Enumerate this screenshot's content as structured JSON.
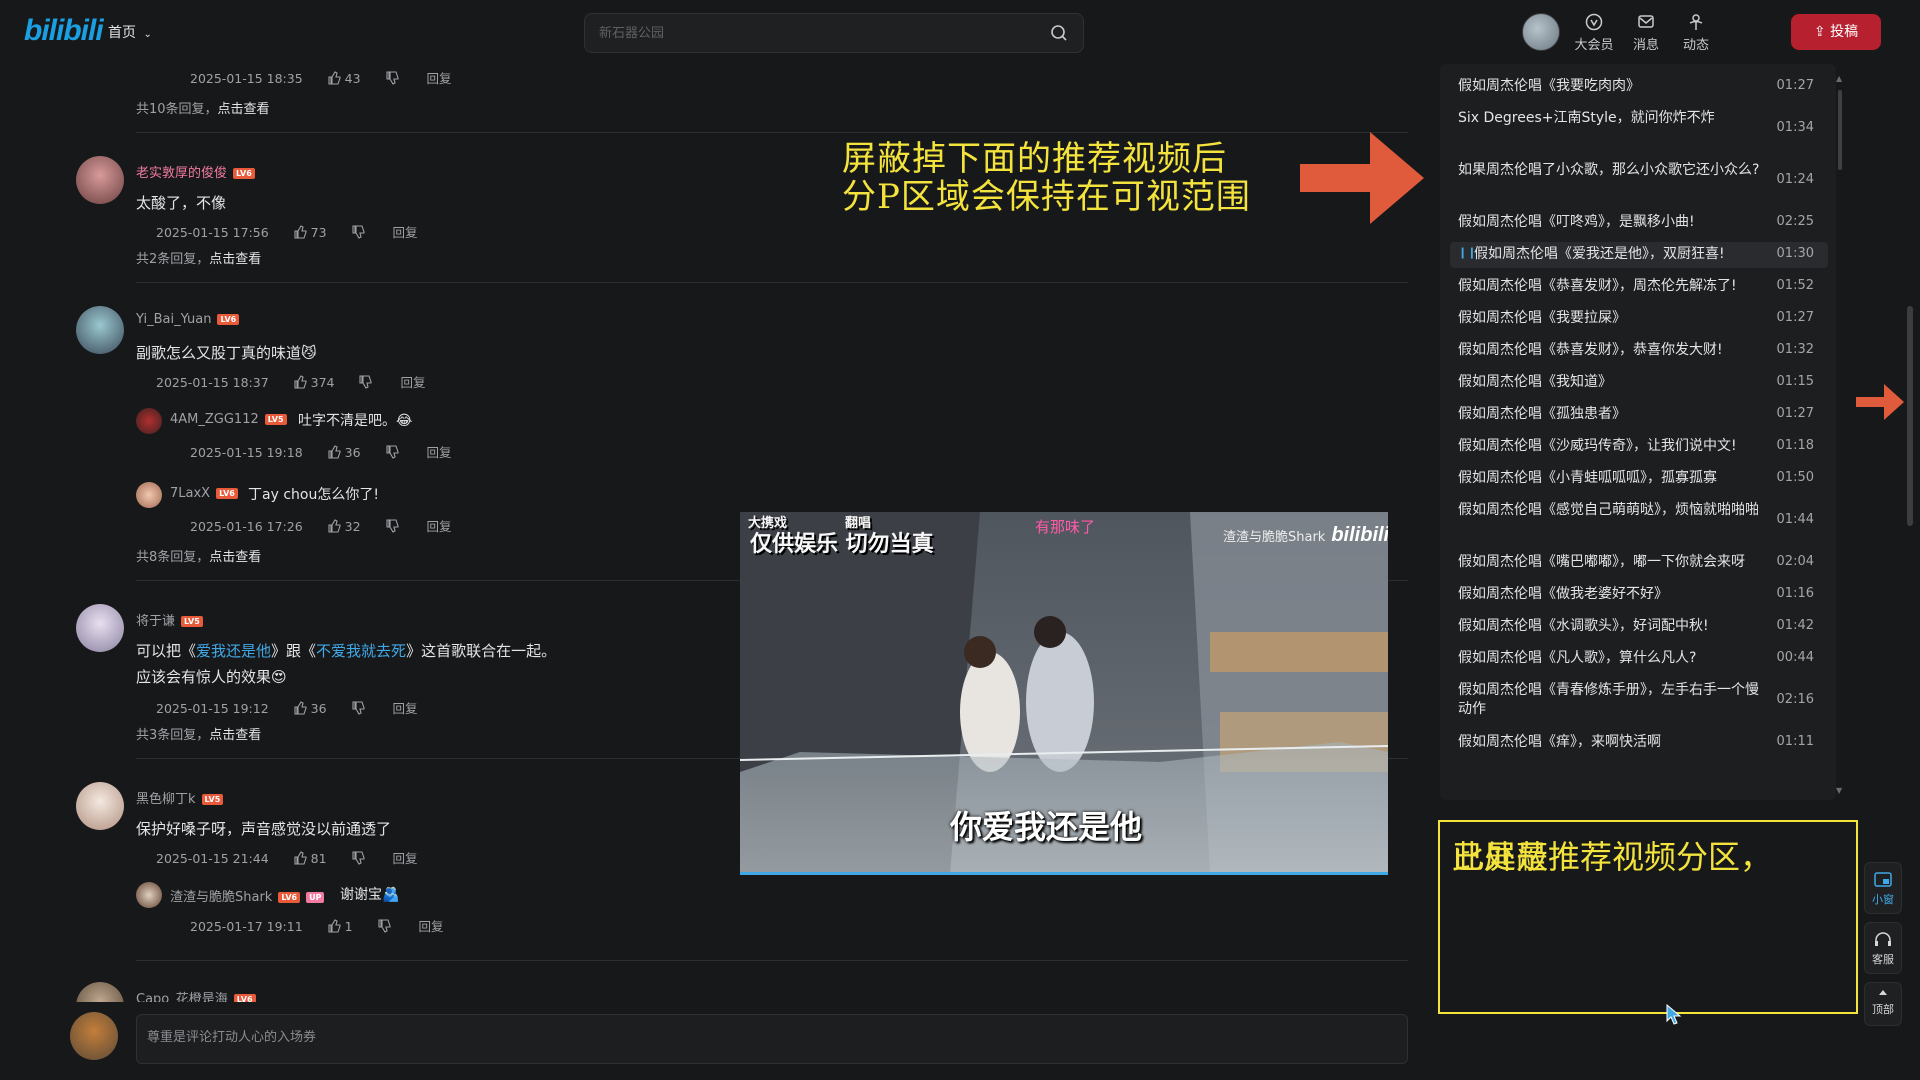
{
  "header": {
    "logo": "bilibili",
    "home_label": "首页",
    "search_placeholder": "新石器公园",
    "nav": [
      {
        "label": "大会员",
        "icon": "vip-icon"
      },
      {
        "label": "消息",
        "icon": "message-icon"
      },
      {
        "label": "动态",
        "icon": "feed-icon"
      }
    ],
    "upload_label": "投稿"
  },
  "comments": {
    "top_meta": {
      "time": "2025-01-15 18:35",
      "likes": "43",
      "reply": "回复"
    },
    "top_more": {
      "prefix": "共10条回复，",
      "action": "点击查看"
    },
    "items": [
      {
        "user": "老实敦厚的俊俊",
        "user_color": "#f07aa0",
        "level": "LV6",
        "text": "太酸了，不像",
        "time": "2025-01-15 17:56",
        "likes": "73",
        "reply": "回复",
        "more_prefix": "共2条回复，",
        "more_action": "点击查看"
      },
      {
        "user": "Yi_Bai_Yuan",
        "user_color": "#9fa1a5",
        "level": "LV6",
        "text": "副歌怎么又股丁真的味道😼",
        "time": "2025-01-15 18:37",
        "likes": "374",
        "reply": "回复",
        "subs": [
          {
            "user": "4AM_ZGG112",
            "level": "LV5",
            "text": "吐字不清是吧。😂",
            "time": "2025-01-15 19:18",
            "likes": "36",
            "reply": "回复"
          },
          {
            "user": "7LaxX",
            "level": "LV6",
            "text": "丁ay chou怎么你了!",
            "time": "2025-01-16 17:26",
            "likes": "32",
            "reply": "回复"
          }
        ],
        "more_prefix": "共8条回复，",
        "more_action": "点击查看"
      },
      {
        "user": "将于谦",
        "user_color": "#9fa1a5",
        "level": "LV5",
        "text_a": "可以把《",
        "link1": "爱我还是他",
        "text_b": "》跟《",
        "link2": "不爱我就去死",
        "text_c": "》这首歌联合在一起。",
        "text2": "应该会有惊人的效果😍",
        "time": "2025-01-15 19:12",
        "likes": "36",
        "reply": "回复",
        "more_prefix": "共3条回复，",
        "more_action": "点击查看"
      },
      {
        "user": "黑色柳丁k",
        "user_color": "#9fa1a5",
        "level": "LV5",
        "text": "保护好嗓子呀，声音感觉没以前通透了",
        "time": "2025-01-15 21:44",
        "likes": "81",
        "reply": "回复",
        "subs": [
          {
            "user": "渣渣与脆脆Shark",
            "level": "LV6",
            "up": "UP",
            "text": "谢谢宝🫂",
            "time": "2025-01-17 19:11",
            "likes": "1",
            "reply": "回复"
          }
        ]
      },
      {
        "user": "Capo_花橙是海",
        "level": "LV6"
      }
    ]
  },
  "annotation": {
    "line1": "屏蔽掉下面的推荐视频后",
    "line2": "分P区域会保持在可视范围",
    "hidden_line1": "此处是推荐视频分区，",
    "hidden_line2": "已屏蔽",
    "color": "#f3e33c",
    "arrow_color": "#e05a3c"
  },
  "playlist": [
    {
      "title": "假如周杰伦唱《我要吃肉肉》",
      "dur": "01:27"
    },
    {
      "title": "Six Degrees+江南Style，就问你炸不炸",
      "dur": "01:34"
    },
    {
      "title": "如果周杰伦唱了小众歌，那么小众歌它还小众么?",
      "dur": "01:24"
    },
    {
      "title": "假如周杰伦唱《叮咚鸡》，是飘移小曲!",
      "dur": "02:25"
    },
    {
      "title": "假如周杰伦唱《爱我还是他》，双厨狂喜!",
      "dur": "01:30",
      "active": true
    },
    {
      "title": "假如周杰伦唱《恭喜发财》，周杰伦先解冻了!",
      "dur": "01:52"
    },
    {
      "title": "假如周杰伦唱《我要拉屎》",
      "dur": "01:27"
    },
    {
      "title": "假如周杰伦唱《恭喜发财》，恭喜你发大财!",
      "dur": "01:32"
    },
    {
      "title": "假如周杰伦唱《我知道》",
      "dur": "01:15"
    },
    {
      "title": "假如周杰伦唱《孤独患者》",
      "dur": "01:27"
    },
    {
      "title": "假如周杰伦唱《沙威玛传奇》，让我们说中文!",
      "dur": "01:18"
    },
    {
      "title": "假如周杰伦唱《小青蛙呱呱呱》，孤寡孤寡",
      "dur": "01:50"
    },
    {
      "title": "假如周杰伦唱《感觉自己萌萌哒》，烦恼就啪啪啪",
      "dur": "01:44"
    },
    {
      "title": "假如周杰伦唱《嘴巴嘟嘟》，嘟一下你就会来呀",
      "dur": "02:04"
    },
    {
      "title": "假如周杰伦唱《做我老婆好不好》",
      "dur": "01:16"
    },
    {
      "title": "假如周杰伦唱《水调歌头》，好词配中秋!",
      "dur": "01:42"
    },
    {
      "title": "假如周杰伦唱《凡人歌》，算什么凡人?",
      "dur": "00:44"
    },
    {
      "title": "假如周杰伦唱《青春修炼手册》，左手右手一个慢动作",
      "dur": "02:16"
    },
    {
      "title": "假如周杰伦唱《痒》，来啊快活啊",
      "dur": "01:11"
    }
  ],
  "video": {
    "watermark1": "仅供娱乐 切勿当真",
    "watermark_top1": "大携戏",
    "watermark_top2": "翻唱",
    "tag": "有那味了",
    "brand": "渣渣与脆脆Shark",
    "brand_logo": "bilibili",
    "subtitle": "你爱我还是他"
  },
  "side_tools": [
    {
      "label": "小窗",
      "icon": "mini-window-icon",
      "color": "#41a8e6"
    },
    {
      "label": "客服",
      "icon": "headset-icon",
      "color": "#d4d6d9"
    },
    {
      "label": "顶部",
      "icon": "back-to-top-icon",
      "color": "#d4d6d9"
    }
  ],
  "comment_box": {
    "placeholder": "尊重是评论打动人心的入场券"
  }
}
